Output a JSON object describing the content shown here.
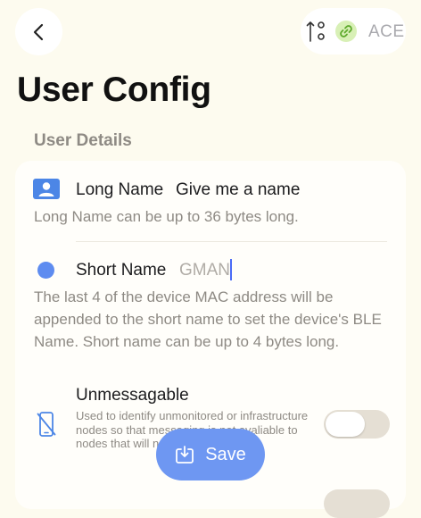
{
  "nav": {
    "back_icon": "chevron-left-icon"
  },
  "status": {
    "sort_icon": "sort-arrows-icon",
    "link_icon": "link-icon",
    "node_short_name": "ACE"
  },
  "page": {
    "title": "User Config",
    "section_header": "User Details"
  },
  "long_name": {
    "icon": "person-card-icon",
    "label": "Long Name",
    "placeholder": "Give me a name",
    "help": "Long Name can be up to 36 bytes long."
  },
  "short_name": {
    "icon": "blue-dot-icon",
    "label": "Short Name",
    "placeholder": "GMAN",
    "help": "The last 4 of the device MAC address will be appended to the short name to set the device's BLE Name.  Short name can be up to 4 bytes long."
  },
  "unmessagable": {
    "icon": "phone-slash-icon",
    "label": "Unmessagable",
    "desc": "Used to identify unmonitored or infrastructure nodes so that messaging is not avaliable to nodes that will never respond.",
    "enabled": false
  },
  "save": {
    "label": "Save",
    "icon": "save-download-icon"
  },
  "colors": {
    "accent": "#6e97f2",
    "background": "#fdfbef",
    "link_bg": "#d8f0b6"
  }
}
